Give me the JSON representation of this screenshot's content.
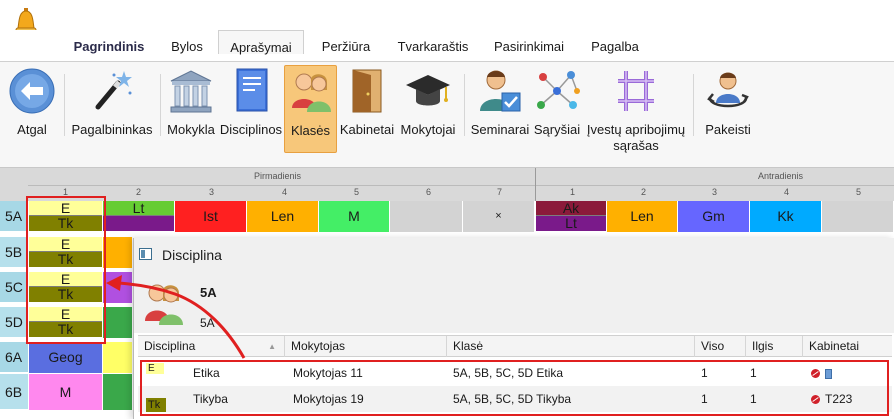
{
  "ribbon": {
    "menu_tabs": [
      "Pagrindinis",
      "Bylos",
      "Aprašymai",
      "Peržiūra",
      "Tvarkaraštis",
      "Pasirinkimai",
      "Pagalba"
    ],
    "tools": {
      "back": "Atgal",
      "wizard": "Pagalbininkas",
      "school": "Mokykla",
      "subjects": "Disciplinos",
      "classes": "Klasės",
      "rooms": "Kabinetai",
      "teachers": "Mokytojai",
      "seminars": "Seminarai",
      "relations": "Sąryšiai",
      "constraints_1": "Įvestų apribojimų",
      "constraints_2": "sąrašas",
      "change": "Pakeisti"
    }
  },
  "timetable": {
    "days": [
      "Pirmadienis",
      "Antradienis"
    ],
    "periods_day1": [
      "1",
      "2",
      "3",
      "4",
      "5",
      "6",
      "7"
    ],
    "periods_day2": [
      "1",
      "2",
      "3",
      "4",
      "5"
    ],
    "classes": [
      "5A",
      "5B",
      "5C",
      "5D",
      "6A",
      "6B"
    ],
    "row_5a": {
      "p1_top": "E",
      "p1_bot": "Tk",
      "p2_top": "Lt",
      "p2_bot": "",
      "p3": "Ist",
      "p4": "Len",
      "p5": "M",
      "p6": "",
      "p7": "×",
      "d2p1_top": "Ak",
      "d2p1_bot": "Lt",
      "d2p2": "Len",
      "d2p3": "Gm",
      "d2p4": "Kk",
      "d2p5": ""
    },
    "row_5b": {
      "top": "E",
      "bot": "Tk"
    },
    "row_5c": {
      "top": "E",
      "bot": "Tk"
    },
    "row_5d": {
      "top": "E",
      "bot": "Tk"
    },
    "row_6a": {
      "p1": "Geog"
    },
    "row_6b": {
      "p1": "M"
    },
    "colors": {
      "etika": "#ffff99",
      "tikyba": "#808000",
      "lt": "#66cc33",
      "lt_bottom": "#7a1a8a",
      "ist": "#ff2020",
      "len": "#ffb000",
      "m": "#44ee66",
      "ak": "#8b1a3a",
      "gm": "#6666ff",
      "kk": "#00aaff",
      "geog": "#5a6ee0",
      "m6b": "#ff88ee"
    }
  },
  "discipline_window": {
    "title": "Disciplina",
    "class_name": "5A",
    "class_sub": "5A",
    "columns": [
      "Disciplina",
      "Mokytojas",
      "Klasė",
      "Viso",
      "Ilgis",
      "Kabinetai"
    ],
    "rows": [
      {
        "tag": "E",
        "name": "Etika",
        "teacher": "Mokytojas 11",
        "classes": "5A, 5B, 5C, 5D Etika",
        "total": "1",
        "length": "1",
        "room": ""
      },
      {
        "tag": "Tk",
        "name": "Tikyba",
        "teacher": "Mokytojas 19",
        "classes": "5A, 5B, 5C, 5D Tikyba",
        "total": "1",
        "length": "1",
        "room": "T223"
      }
    ]
  }
}
